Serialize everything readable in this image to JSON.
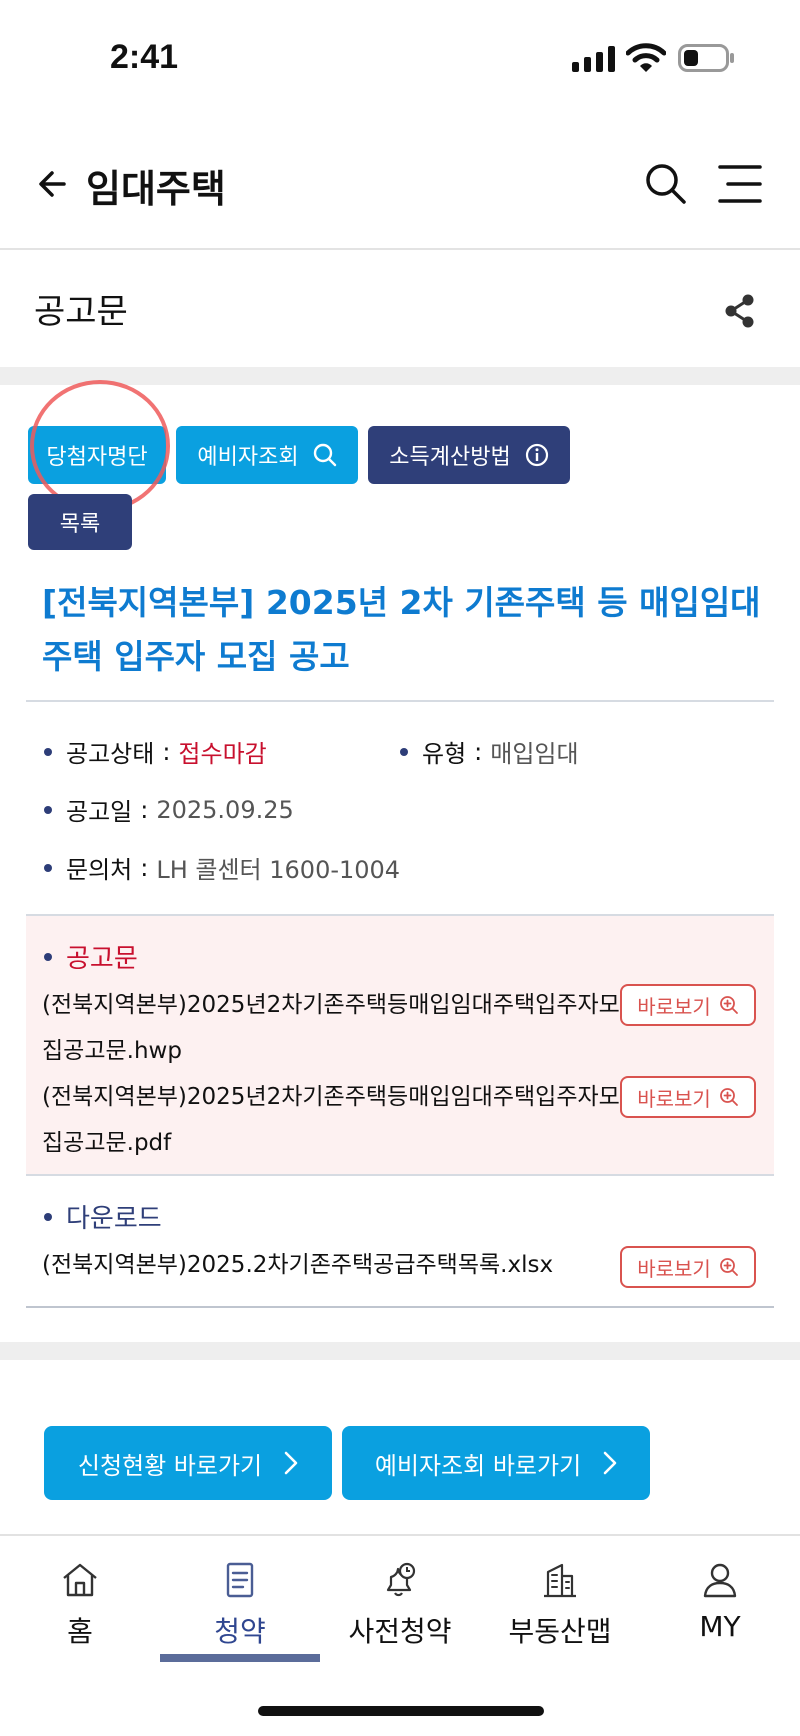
{
  "status_bar": {
    "time": "2:41"
  },
  "header": {
    "title": "임대주택"
  },
  "section": {
    "title": "공고문"
  },
  "buttons": {
    "winners": "당첨자명단",
    "reserve": "예비자조회",
    "income": "소득계산방법",
    "list": "목록"
  },
  "notice": {
    "title": "[전북지역본부] 2025년 2차 기존주택 등 매입임대주택 입주자 모집 공고",
    "status_key": "공고상태",
    "status_value": "접수마감",
    "type_key": "유형",
    "type_value": "매입임대",
    "date_key": "공고일",
    "date_value": "2025.09.25",
    "contact_key": "문의처",
    "contact_value": "LH 콜센터 1600-1004",
    "sep": ":"
  },
  "documents": {
    "heading": "공고문",
    "files": [
      {
        "name": "(전북지역본부)2025년2차기존주택등매입임대주택입주자모집공고문.hwp"
      },
      {
        "name": "(전북지역본부)2025년2차기존주택등매입임대주택입주자모집공고문.pdf"
      }
    ]
  },
  "downloads": {
    "heading": "다운로드",
    "files": [
      {
        "name": "(전북지역본부)2025.2차기존주택공급주택목록.xlsx"
      }
    ]
  },
  "view_label": "바로보기",
  "bottom_buttons": {
    "apply_status": "신청현황 바로가기",
    "reserve_check": "예비자조회 바로가기"
  },
  "tabs": [
    {
      "label": "홈",
      "icon": "home-icon"
    },
    {
      "label": "청약",
      "icon": "document-icon",
      "active": true
    },
    {
      "label": "사전청약",
      "icon": "bell-clock-icon"
    },
    {
      "label": "부동산맵",
      "icon": "building-icon"
    },
    {
      "label": "MY",
      "icon": "person-icon"
    }
  ],
  "colors": {
    "accent_blue": "#0aa0e0",
    "navy": "#2f3f79",
    "title_blue": "#0e7bd0",
    "status_red": "#c8102e"
  }
}
